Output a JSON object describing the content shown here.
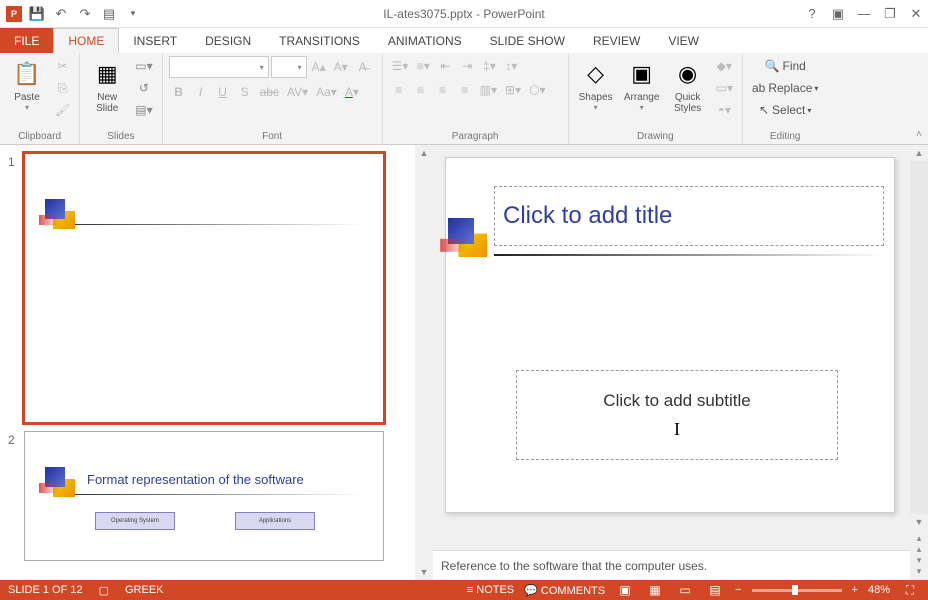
{
  "title": "IL-ates3075.pptx - PowerPoint",
  "tabs": {
    "file": "FILE",
    "home": "HOME",
    "insert": "INSERT",
    "design": "DESIGN",
    "transitions": "TRANSITIONS",
    "animations": "ANIMATIONS",
    "slideshow": "SLIDE SHOW",
    "review": "REVIEW",
    "view": "VIEW"
  },
  "ribbon": {
    "clipboard": {
      "label": "Clipboard",
      "paste": "Paste"
    },
    "slides": {
      "label": "Slides",
      "newslide": "New\nSlide"
    },
    "font": {
      "label": "Font"
    },
    "paragraph": {
      "label": "Paragraph"
    },
    "drawing": {
      "label": "Drawing",
      "shapes": "Shapes",
      "arrange": "Arrange",
      "quick": "Quick\nStyles"
    },
    "editing": {
      "label": "Editing",
      "find": "Find",
      "replace": "Replace",
      "select": "Select"
    }
  },
  "thumbnails": [
    {
      "num": "1",
      "selected": true
    },
    {
      "num": "2",
      "title": "Format representation of the software",
      "box1": "Operating System",
      "box2": "Applications"
    }
  ],
  "slide": {
    "title_placeholder": "Click to add title",
    "subtitle_placeholder": "Click to add subtitle"
  },
  "notes": "Reference to the software that the computer uses.",
  "status": {
    "slide": "SLIDE 1 OF 12",
    "lang": "GREEK",
    "notes": "NOTES",
    "comments": "COMMENTS",
    "zoom": "48%"
  }
}
